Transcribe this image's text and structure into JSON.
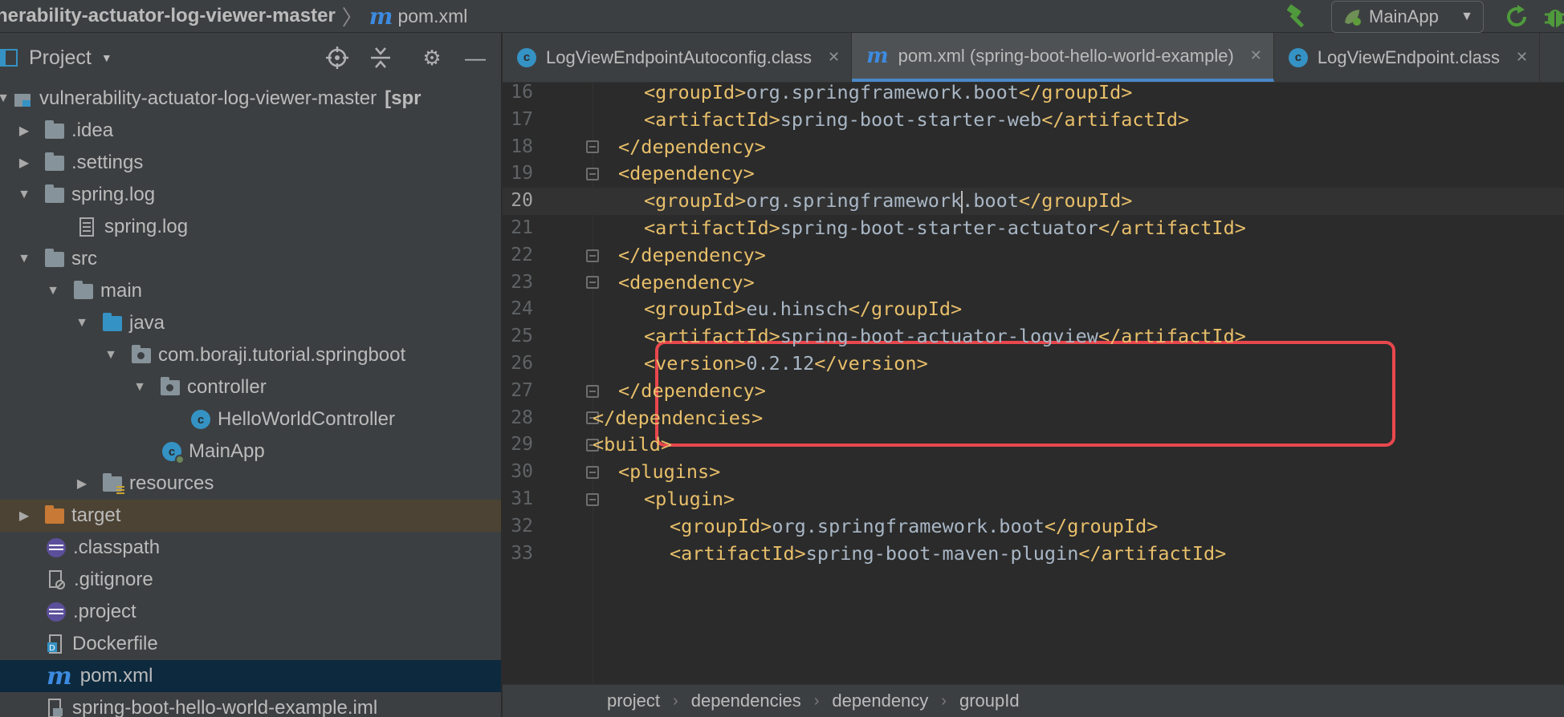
{
  "navbar": {
    "project_crumb": "nerability-actuator-log-viewer-master",
    "file_crumb": "pom.xml",
    "run_config": "MainApp"
  },
  "project_pane": {
    "title": "Project",
    "tree": [
      {
        "label": "vulnerability-actuator-log-viewer-master",
        "suffix": "[spr",
        "icon": "module-icon"
      },
      {
        "label": ".idea",
        "icon": "folder-icon"
      },
      {
        "label": ".settings",
        "icon": "folder-icon"
      },
      {
        "label": "spring.log",
        "icon": "folder-icon"
      },
      {
        "label": "spring.log",
        "icon": "log-file-icon"
      },
      {
        "label": "src",
        "icon": "folder-icon"
      },
      {
        "label": "main",
        "icon": "folder-icon"
      },
      {
        "label": "java",
        "icon": "source-folder-icon"
      },
      {
        "label": "com.boraji.tutorial.springboot",
        "icon": "package-icon"
      },
      {
        "label": "controller",
        "icon": "package-icon"
      },
      {
        "label": "HelloWorldController",
        "icon": "class-icon"
      },
      {
        "label": "MainApp",
        "icon": "spring-boot-class-icon"
      },
      {
        "label": "resources",
        "icon": "resources-folder-icon"
      },
      {
        "label": "target",
        "icon": "excluded-folder-icon"
      },
      {
        "label": ".classpath",
        "icon": "eclipse-file-icon"
      },
      {
        "label": ".gitignore",
        "icon": "ignore-file-icon"
      },
      {
        "label": ".project",
        "icon": "eclipse-file-icon"
      },
      {
        "label": "Dockerfile",
        "icon": "docker-file-icon"
      },
      {
        "label": "pom.xml",
        "icon": "maven-icon"
      },
      {
        "label": "spring-boot-hello-world-example.iml",
        "icon": "iml-file-icon"
      }
    ]
  },
  "tabs": [
    {
      "label": "LogViewEndpointAutoconfig.class",
      "icon": "class-icon",
      "active": false
    },
    {
      "label": "pom.xml (spring-boot-hello-world-example)",
      "icon": "maven-icon",
      "active": true
    },
    {
      "label": "LogViewEndpoint.class",
      "icon": "class-icon",
      "active": false
    }
  ],
  "code": [
    {
      "n": "16",
      "indent": 3,
      "open": "<groupId>",
      "text": "org.springframework.boot",
      "close": "</groupId>"
    },
    {
      "n": "17",
      "indent": 3,
      "open": "<artifactId>",
      "text": "spring-boot-starter-web",
      "close": "</artifactId>"
    },
    {
      "n": "18",
      "indent": 2,
      "open": "</dependency>",
      "text": "",
      "close": ""
    },
    {
      "n": "19",
      "indent": 2,
      "open": "<dependency>",
      "text": "",
      "close": ""
    },
    {
      "n": "20",
      "indent": 3,
      "open": "<groupId>",
      "text_before_caret": "org.springframework",
      "text_after_caret": ".boot",
      "close": "</groupId>"
    },
    {
      "n": "21",
      "indent": 3,
      "open": "<artifactId>",
      "text": "spring-boot-starter-actuator",
      "close": "</artifactId>"
    },
    {
      "n": "22",
      "indent": 2,
      "open": "</dependency>",
      "text": "",
      "close": ""
    },
    {
      "n": "23",
      "indent": 2,
      "open": "<dependency>",
      "text": "",
      "close": ""
    },
    {
      "n": "24",
      "indent": 3,
      "open": "<groupId>",
      "text": "eu.hinsch",
      "close": "</groupId>"
    },
    {
      "n": "25",
      "indent": 3,
      "open": "<artifactId>",
      "text": "spring-boot-actuator-logview",
      "close": "</artifactId>"
    },
    {
      "n": "26",
      "indent": 3,
      "open": "<version>",
      "text": "0.2.12",
      "close": "</version>"
    },
    {
      "n": "27",
      "indent": 2,
      "open": "</dependency>",
      "text": "",
      "close": ""
    },
    {
      "n": "28",
      "indent": 1,
      "open": "</dependencies>",
      "text": "",
      "close": ""
    },
    {
      "n": "29",
      "indent": 1,
      "open": "<build>",
      "text": "",
      "close": ""
    },
    {
      "n": "30",
      "indent": 2,
      "open": "<plugins>",
      "text": "",
      "close": ""
    },
    {
      "n": "31",
      "indent": 3,
      "open": "<plugin>",
      "text": "",
      "close": ""
    },
    {
      "n": "32",
      "indent": 4,
      "open": "<groupId>",
      "text": "org.springframework.boot",
      "close": "</groupId>"
    },
    {
      "n": "33",
      "indent": 4,
      "open": "<artifactId>",
      "text": "spring-boot-maven-plugin",
      "close": "</artifactId>"
    }
  ],
  "breadcrumbs": [
    "project",
    "dependencies",
    "dependency",
    "groupId"
  ],
  "colors": {
    "tag": "#e8bf6a",
    "text": "#a9b7c6",
    "highlight_box": "#e8474d",
    "selection": "#0d293e"
  }
}
